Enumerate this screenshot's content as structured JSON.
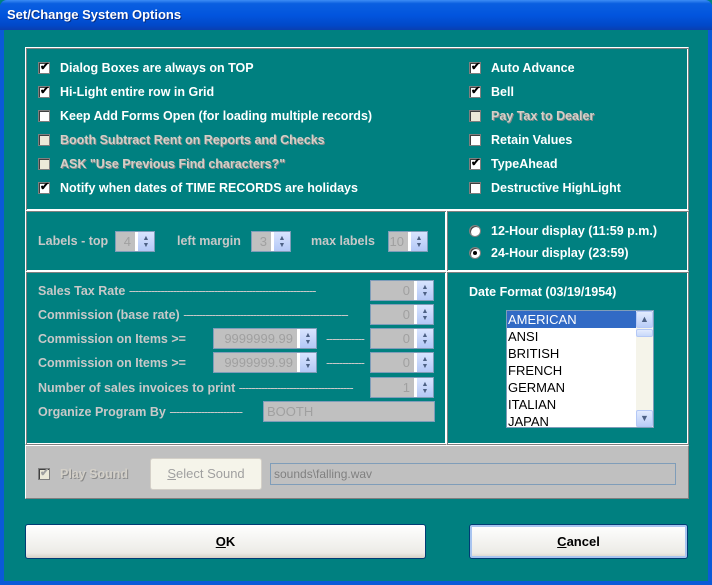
{
  "window": {
    "title": "Set/Change System Options"
  },
  "options_left": [
    {
      "label": "Dialog Boxes are always on TOP",
      "checked": true,
      "disabled": false
    },
    {
      "label": "Hi-Light entire row in Grid",
      "checked": true,
      "disabled": false
    },
    {
      "label": "Keep Add Forms Open (for loading multiple records)",
      "checked": false,
      "disabled": false
    },
    {
      "label": "Booth Subtract Rent on Reports and Checks",
      "checked": false,
      "disabled": true
    },
    {
      "label": "ASK \"Use Previous Find characters?\"",
      "checked": false,
      "disabled": true
    },
    {
      "label": "Notify when dates of TIME RECORDS are holidays",
      "checked": true,
      "disabled": false
    }
  ],
  "options_right": [
    {
      "label": "Auto Advance",
      "checked": true,
      "disabled": false
    },
    {
      "label": "Bell",
      "checked": true,
      "disabled": false
    },
    {
      "label": "Pay Tax to Dealer",
      "checked": false,
      "disabled": true
    },
    {
      "label": "Retain Values",
      "checked": false,
      "disabled": false
    },
    {
      "label": "TypeAhead",
      "checked": true,
      "disabled": false
    },
    {
      "label": "Destructive HighLight",
      "checked": false,
      "disabled": false
    }
  ],
  "labels": {
    "top_label": "Labels - top",
    "top_value": "4",
    "left_margin_label": "left margin",
    "left_margin_value": "3",
    "max_labels_label": "max labels",
    "max_labels_value": "10"
  },
  "time_display": {
    "options": [
      {
        "label": "12-Hour display (11:59 p.m.)",
        "selected": false
      },
      {
        "label": "24-Hour display (23:59)",
        "selected": true
      }
    ]
  },
  "sales": {
    "sales_tax_label": "Sales Tax Rate",
    "sales_tax_value": "0",
    "commission_base_label": "Commission (base rate)",
    "commission_base_value": "0",
    "commission_items_1_label": "Commission on Items >=",
    "commission_items_1_threshold": "9999999.99",
    "commission_items_1_value": "0",
    "commission_items_2_label": "Commission on Items >=",
    "commission_items_2_threshold": "9999999.99",
    "commission_items_2_value": "0",
    "invoices_label": "Number of sales invoices to print",
    "invoices_value": "1",
    "organize_label": "Organize Program By",
    "organize_value": "BOOTH"
  },
  "date_format": {
    "label": "Date Format (03/19/1954)",
    "options": [
      "AMERICAN",
      "ANSI",
      "BRITISH",
      "FRENCH",
      "GERMAN",
      "ITALIAN",
      "JAPAN"
    ],
    "selected": "AMERICAN"
  },
  "sound": {
    "play_sound_label": "Play Sound",
    "play_sound_checked": true,
    "select_sound_label": "Select Sound",
    "path": "sounds\\falling.wav"
  },
  "buttons": {
    "ok_label": "OK",
    "cancel_label": "Cancel"
  }
}
